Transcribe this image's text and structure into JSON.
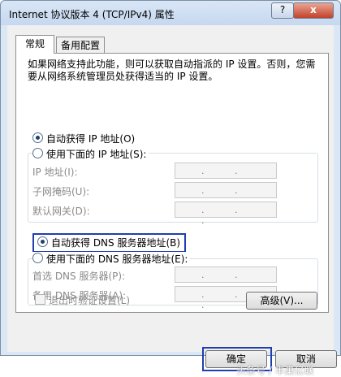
{
  "window": {
    "title": "Internet 协议版本 4 (TCP/IPv4) 属性",
    "help_glyph": "?",
    "close_glyph": "x"
  },
  "tabs": [
    "常规",
    "备用配置"
  ],
  "description": "如果网络支持此功能，则可以获取自动指派的 IP 设置。否则，您需要从网络系统管理员处获得适当的 IP 设置。",
  "ip": {
    "auto_label": "自动获得 IP 地址(O)",
    "manual_label": "使用下面的 IP 地址(S):",
    "auto_selected": true,
    "fields": [
      {
        "label": "IP 地址(I):",
        "value": ". . ."
      },
      {
        "label": "子网掩码(U):",
        "value": ". . ."
      },
      {
        "label": "默认网关(D):",
        "value": ". . ."
      }
    ]
  },
  "dns": {
    "auto_label": "自动获得 DNS 服务器地址(B)",
    "manual_label": "使用下面的 DNS 服务器地址(E):",
    "auto_selected": true,
    "fields": [
      {
        "label": "首选 DNS 服务器(P):",
        "value": ". . ."
      },
      {
        "label": "备用 DNS 服务器(A):",
        "value": ". . ."
      }
    ]
  },
  "validate_label": "退出时验证设置(L)",
  "buttons": {
    "advanced": "高级(V)...",
    "ok": "确定",
    "cancel": "取消"
  },
  "watermark": "头条号 / 丰巢亿联",
  "colors": {
    "highlight": "#1f3fb0",
    "window_frame": "#dbe7f5"
  }
}
